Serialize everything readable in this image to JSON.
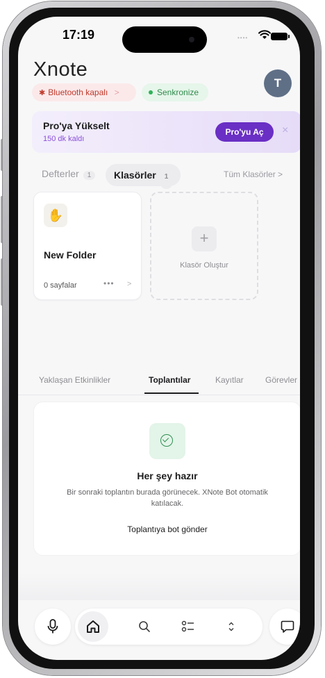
{
  "status_bar": {
    "time": "17:19"
  },
  "header": {
    "logo": "Xnote",
    "avatar_initial": "T"
  },
  "chips": {
    "bluetooth": "Bluetooth kapalı",
    "bluetooth_arrow": ">",
    "sync": "Senkronize"
  },
  "promo": {
    "title": "Pro'ya Yükselt",
    "subtitle": "150 dk kaldı",
    "button": "Pro'yu Aç",
    "close": "×"
  },
  "folder_tabs": {
    "notebooks": {
      "label": "Defterler",
      "count": "1"
    },
    "folders": {
      "label": "Klasörler",
      "count": "1"
    },
    "all_folders": "Tüm Klasörler >"
  },
  "folder_card": {
    "icon": "✋",
    "title": "New Folder",
    "pages": "0 sayfalar",
    "more": "•••",
    "arrow": ">"
  },
  "create_card": {
    "plus": "+",
    "label": "Klasör Oluştur"
  },
  "content_tabs": [
    {
      "label": "Yaklaşan Etkinlikler",
      "active": false
    },
    {
      "label": "Toplantılar",
      "active": true
    },
    {
      "label": "Kayıtlar",
      "active": false
    },
    {
      "label": "Görevler",
      "active": false
    }
  ],
  "empty_state": {
    "title": "Her şey hazır",
    "description": "Bir sonraki toplantın burada görünecek. XNote Bot otomatik katılacak.",
    "action": "Toplantıya bot gönder"
  },
  "bottom_nav": {
    "icons": [
      "microphone-icon",
      "home-icon",
      "search-icon",
      "task-list-icon",
      "chevron-updown-icon",
      "chat-bubble-icon"
    ]
  },
  "colors": {
    "accent_purple": "#6a2fc4",
    "danger_red": "#c0392b",
    "success_green": "#2e8b4c"
  }
}
